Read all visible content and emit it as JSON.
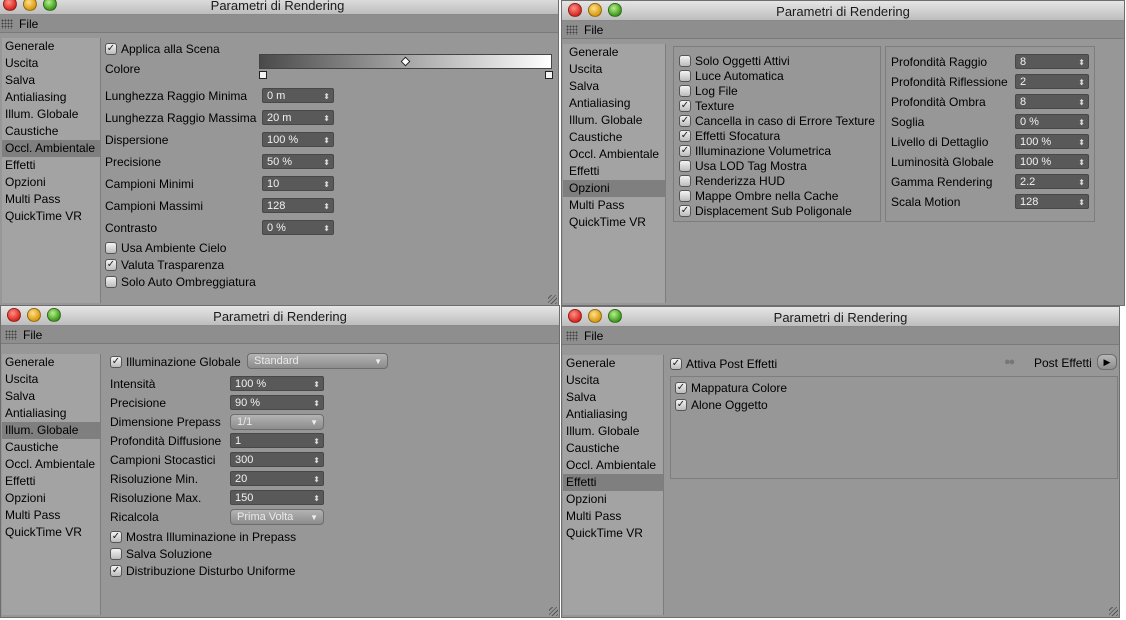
{
  "window_title": "Parametri di Rendering",
  "menu_file": "File",
  "sidebar": [
    "Generale",
    "Uscita",
    "Salva",
    "Antialiasing",
    "Illum. Globale",
    "Caustiche",
    "Occl. Ambientale",
    "Effetti",
    "Opzioni",
    "Multi Pass",
    "QuickTime VR"
  ],
  "ambient": {
    "applica": "Applica alla Scena",
    "colore": "Colore",
    "fields": [
      {
        "label": "Lunghezza Raggio Minima",
        "value": "0 m"
      },
      {
        "label": "Lunghezza Raggio Massima",
        "value": "20 m"
      },
      {
        "label": "Dispersione",
        "value": "100 %"
      },
      {
        "label": "Precisione",
        "value": "50 %"
      },
      {
        "label": "Campioni Minimi",
        "value": "10"
      },
      {
        "label": "Campioni Massimi",
        "value": "128"
      },
      {
        "label": "Contrasto",
        "value": "0 %"
      }
    ],
    "checks": [
      {
        "label": "Usa Ambiente Cielo",
        "checked": false
      },
      {
        "label": "Valuta Trasparenza",
        "checked": true
      },
      {
        "label": "Solo Auto Ombreggiatura",
        "checked": false
      }
    ]
  },
  "options": {
    "checks": [
      {
        "label": "Solo Oggetti Attivi",
        "checked": false
      },
      {
        "label": "Luce Automatica",
        "checked": false
      },
      {
        "label": "Log File",
        "checked": false
      },
      {
        "label": "Texture",
        "checked": true
      },
      {
        "label": "Cancella in caso di Errore Texture",
        "checked": true
      },
      {
        "label": "Effetti Sfocatura",
        "checked": true
      },
      {
        "label": "Illuminazione Volumetrica",
        "checked": true
      },
      {
        "label": "Usa LOD Tag Mostra",
        "checked": false
      },
      {
        "label": "Renderizza HUD",
        "checked": false
      },
      {
        "label": "Mappe Ombre nella Cache",
        "checked": false
      },
      {
        "label": "Displacement Sub Poligonale",
        "checked": true
      }
    ],
    "fields": [
      {
        "label": "Profondità Raggio",
        "value": "8"
      },
      {
        "label": "Profondità Riflessione",
        "value": "2"
      },
      {
        "label": "Profondità Ombra",
        "value": "8"
      },
      {
        "label": "Soglia",
        "value": "0 %"
      },
      {
        "label": "Livello di Dettaglio",
        "value": "100 %"
      },
      {
        "label": "Luminosità Globale",
        "value": "100 %"
      },
      {
        "label": "Gamma Rendering",
        "value": "2.2"
      },
      {
        "label": "Scala Motion",
        "value": "128"
      }
    ]
  },
  "gi": {
    "enable": "Illuminazione Globale",
    "mode": "Standard",
    "fields": [
      {
        "label": "Intensità",
        "value": "100 %"
      },
      {
        "label": "Precisione",
        "value": "90 %"
      },
      {
        "label": "Dimensione Prepass",
        "value": "1/1"
      },
      {
        "label": "Profondità Diffusione",
        "value": "1"
      },
      {
        "label": "Campioni Stocastici",
        "value": "300"
      },
      {
        "label": "Risoluzione Min.",
        "value": "20"
      },
      {
        "label": "Risoluzione Max.",
        "value": "150"
      },
      {
        "label": "Ricalcola",
        "value": "Prima Volta"
      }
    ],
    "checks": [
      {
        "label": "Mostra Illuminazione in Prepass",
        "checked": true
      },
      {
        "label": "Salva Soluzione",
        "checked": false
      },
      {
        "label": "Distribuzione Disturbo Uniforme",
        "checked": true
      }
    ]
  },
  "effects": {
    "enable": "Attiva Post Effetti",
    "button": "Post Effetti",
    "items": [
      {
        "label": "Mappatura Colore",
        "checked": true
      },
      {
        "label": "Alone Oggetto",
        "checked": true
      }
    ]
  },
  "colors": {
    "window_bg": "#979797",
    "sidebar_bg": "#a3a3a3",
    "selected": "#7f7f7f",
    "field_bg": "#595959"
  }
}
